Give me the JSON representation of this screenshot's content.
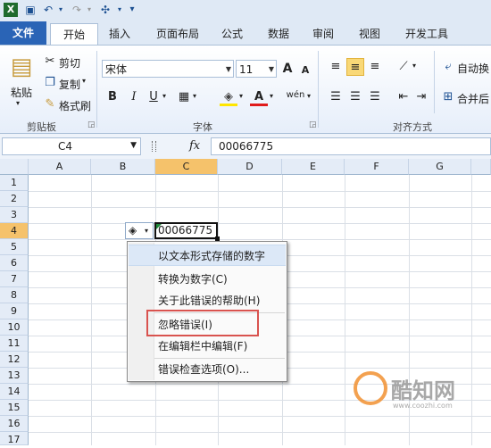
{
  "qat": {
    "dropdown": "▾"
  },
  "tabs": [
    "文件",
    "开始",
    "插入",
    "页面布局",
    "公式",
    "数据",
    "审阅",
    "视图",
    "开发工具"
  ],
  "ribbon": {
    "paste": "粘贴",
    "cut": "剪切",
    "copy": "复制",
    "format_painter": "格式刷",
    "clipboard_label": "剪贴板",
    "font_name": "宋体",
    "font_size": "11",
    "grow_font": "A",
    "shrink_font": "A",
    "bold": "B",
    "italic": "I",
    "underline": "U",
    "font_color": "A",
    "phonetic": "wén",
    "font_label": "字体",
    "wrap_text": "自动换",
    "merge_center": "合并后",
    "align_label": "对齐方式"
  },
  "formula_bar": {
    "name_box": "C4",
    "fx": "fx",
    "value": "00066775"
  },
  "grid": {
    "columns": [
      "A",
      "B",
      "C",
      "D",
      "E",
      "F",
      "G"
    ],
    "rows": [
      "1",
      "2",
      "3",
      "4",
      "5",
      "6",
      "7",
      "8",
      "9",
      "10",
      "11",
      "12",
      "13",
      "14",
      "15",
      "16",
      "17"
    ],
    "cell_c4": "00066775"
  },
  "menu": {
    "items": [
      "以文本形式存储的数字",
      "转换为数字(C)",
      "关于此错误的帮助(H)",
      "忽略错误(I)",
      "在编辑栏中编辑(F)",
      "错误检查选项(O)..."
    ]
  },
  "watermark": {
    "text": "酷知网",
    "url": "www.coozhi.com"
  },
  "colors": {
    "file_tab": "#2a64b6",
    "highlight": "#d9534f",
    "selected_col": "#f5c26b"
  }
}
